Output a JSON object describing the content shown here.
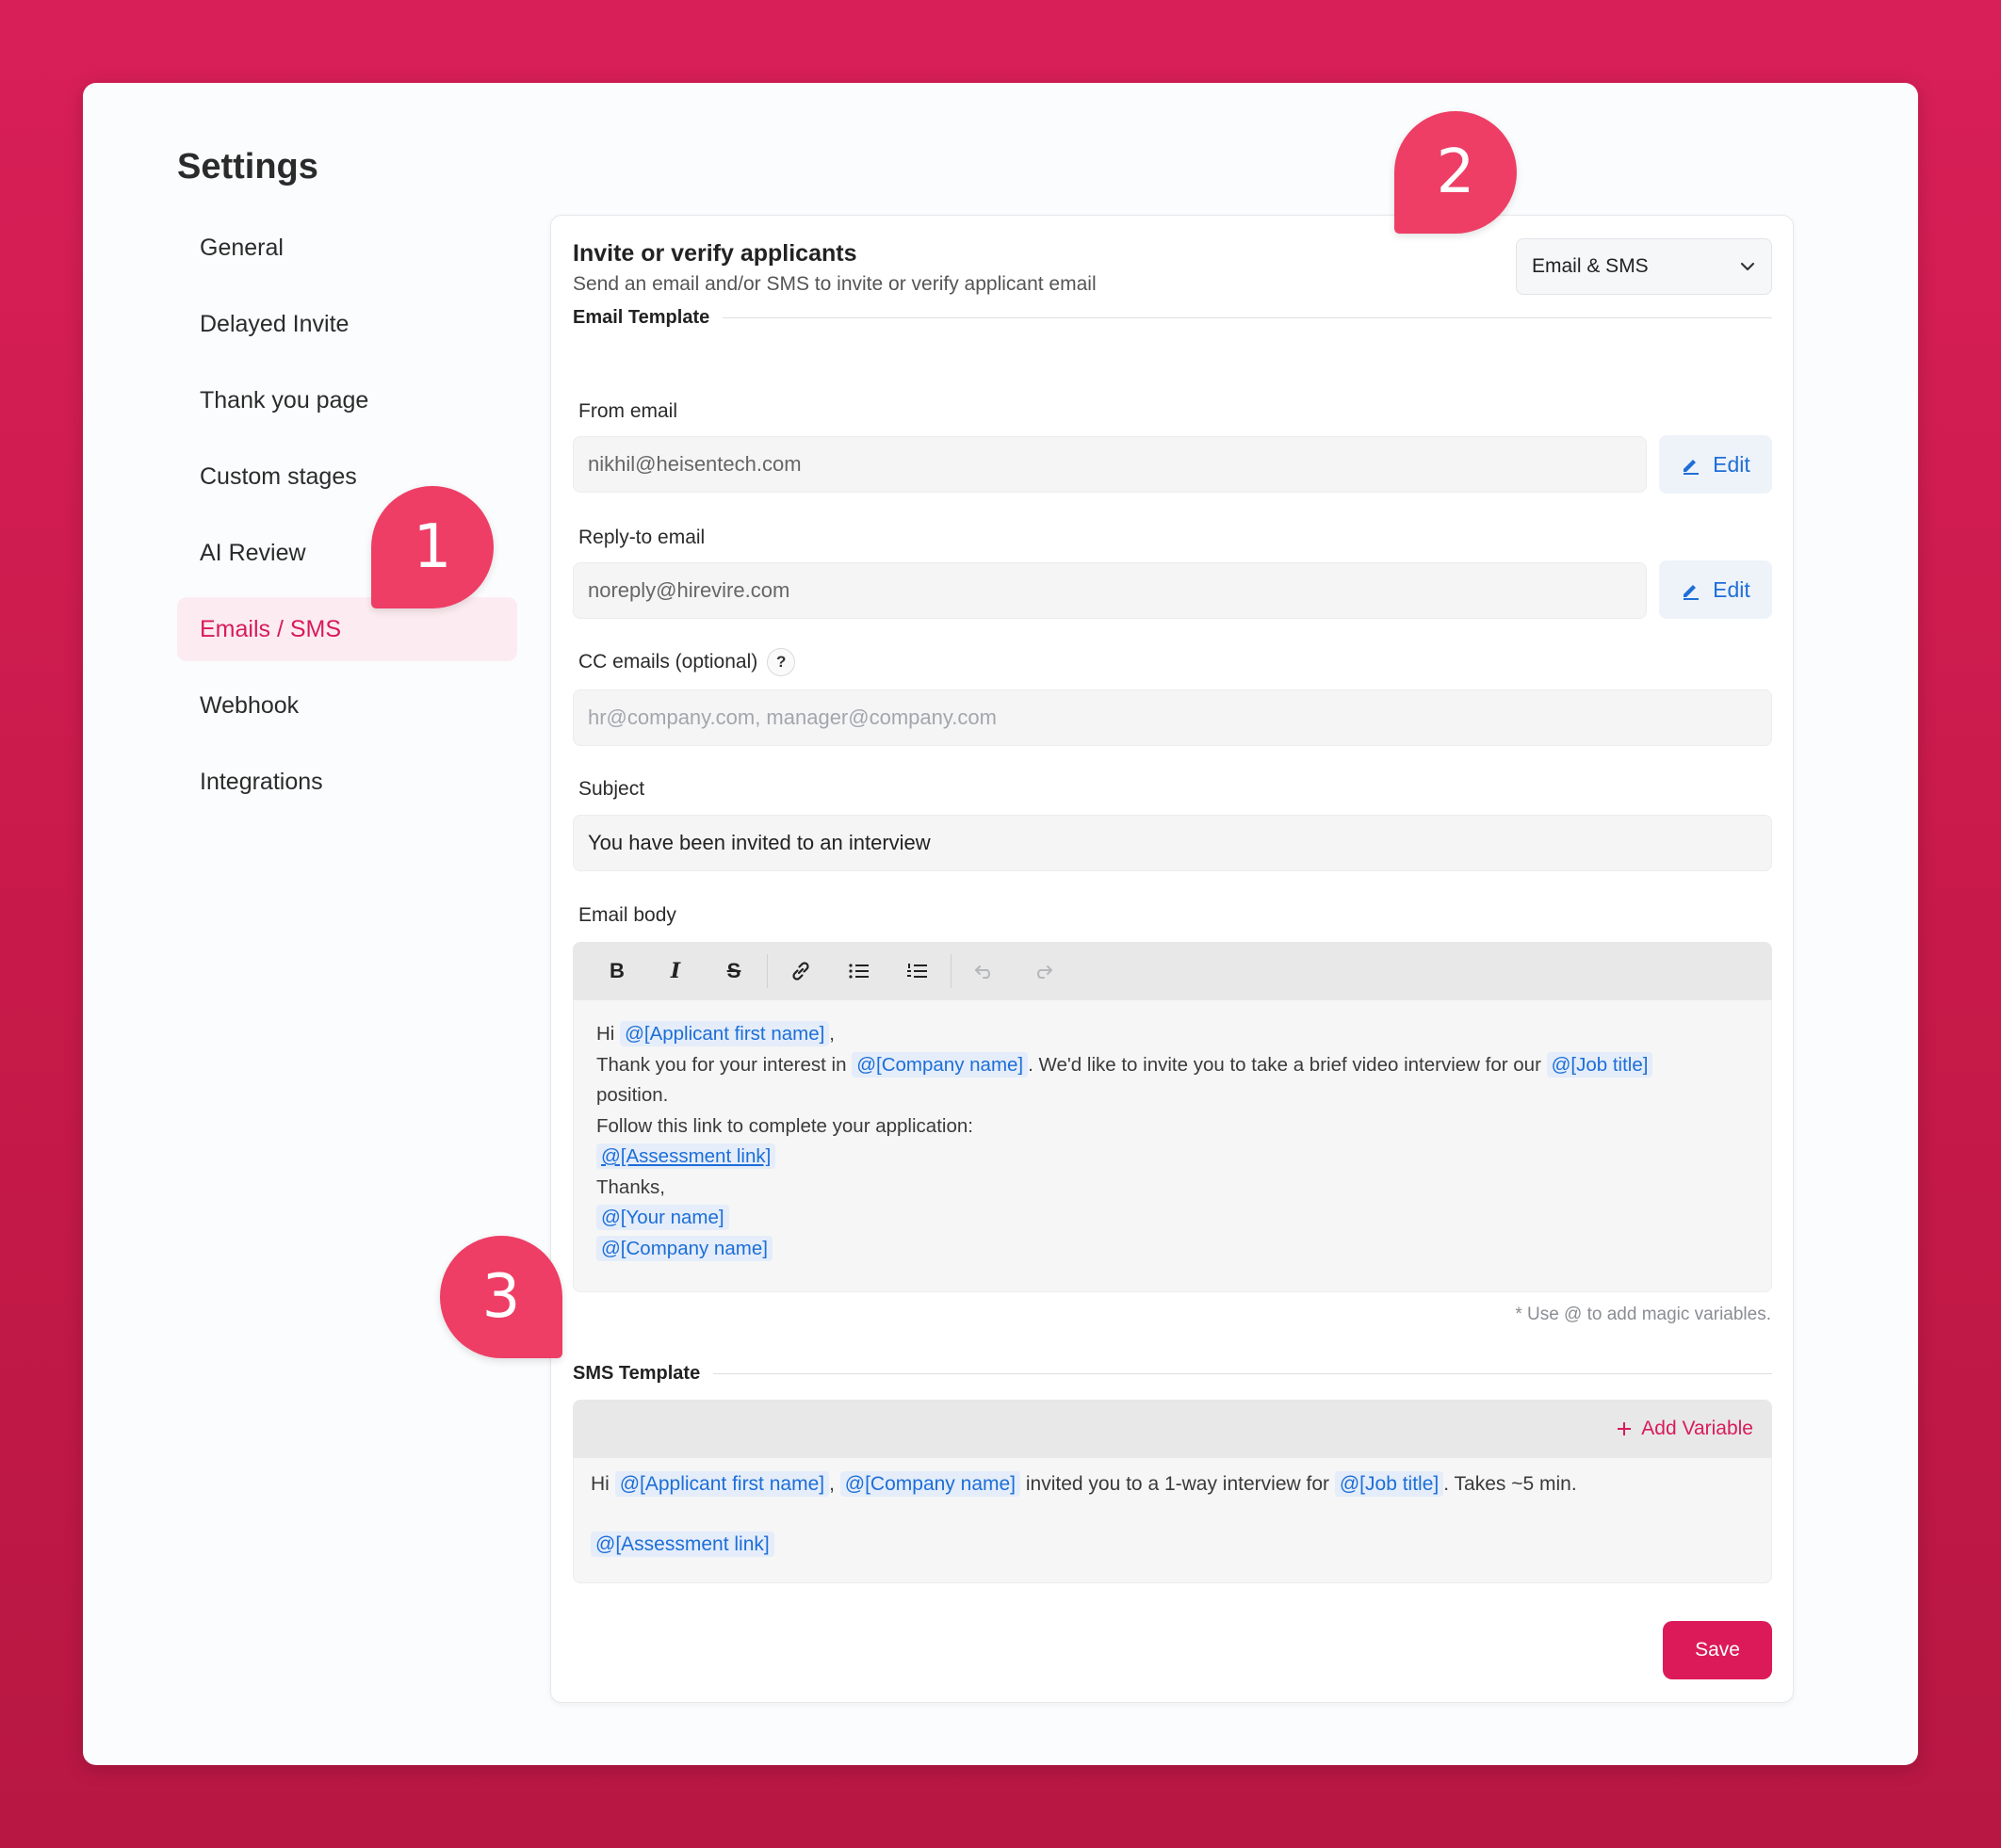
{
  "settings_title": "Settings",
  "nav": [
    {
      "label": "General"
    },
    {
      "label": "Delayed Invite"
    },
    {
      "label": "Thank you page"
    },
    {
      "label": "Custom stages"
    },
    {
      "label": "AI Review"
    },
    {
      "label": "Emails / SMS",
      "active": true
    },
    {
      "label": "Webhook"
    },
    {
      "label": "Integrations"
    }
  ],
  "panel": {
    "title": "Invite or verify applicants",
    "subtitle": "Send an email and/or SMS to invite or verify applicant email",
    "mode_select": "Email & SMS"
  },
  "email_template": {
    "heading": "Email Template",
    "from_label": "From email",
    "from_value": "nikhil@heisentech.com",
    "reply_label": "Reply-to email",
    "reply_value": "noreply@hirevire.com",
    "edit_label": "Edit",
    "cc_label": "CC emails (optional)",
    "cc_help": "?",
    "cc_placeholder": "hr@company.com, manager@company.com",
    "subject_label": "Subject",
    "subject_value": "You have been invited to an interview",
    "body_label": "Email body",
    "body": {
      "hi": "Hi",
      "var_first_name": "@[Applicant first name]",
      "comma": ",",
      "thanks_prefix": "Thank you for your interest in",
      "var_company": "@[Company name]",
      "invite_text": ". We'd like to invite you to take a brief video interview for our",
      "var_job": "@[Job title]",
      "position": "position.",
      "follow": "Follow this link to complete your application:",
      "var_assessment": "@[Assessment link]",
      "thanks": "Thanks,",
      "var_your_name": "@[Your name]",
      "var_company2": "@[Company name]"
    },
    "hint": "* Use @ to add magic variables."
  },
  "sms_template": {
    "heading": "SMS Template",
    "add_variable": "Add Variable",
    "hi": "Hi",
    "var_first_name": "@[Applicant first name]",
    "comma": ",",
    "var_company": "@[Company name]",
    "invited": "invited you to a 1-way interview for",
    "var_job": "@[Job title]",
    "takes": ". Takes ~5 min.",
    "var_assessment": "@[Assessment link]"
  },
  "save_label": "Save",
  "callouts": [
    "1",
    "2",
    "3"
  ],
  "colors": {
    "brand": "#dc1a59",
    "callout": "#ee3e65",
    "variable": "#1d6ed8",
    "link": "#1f6fd6"
  }
}
